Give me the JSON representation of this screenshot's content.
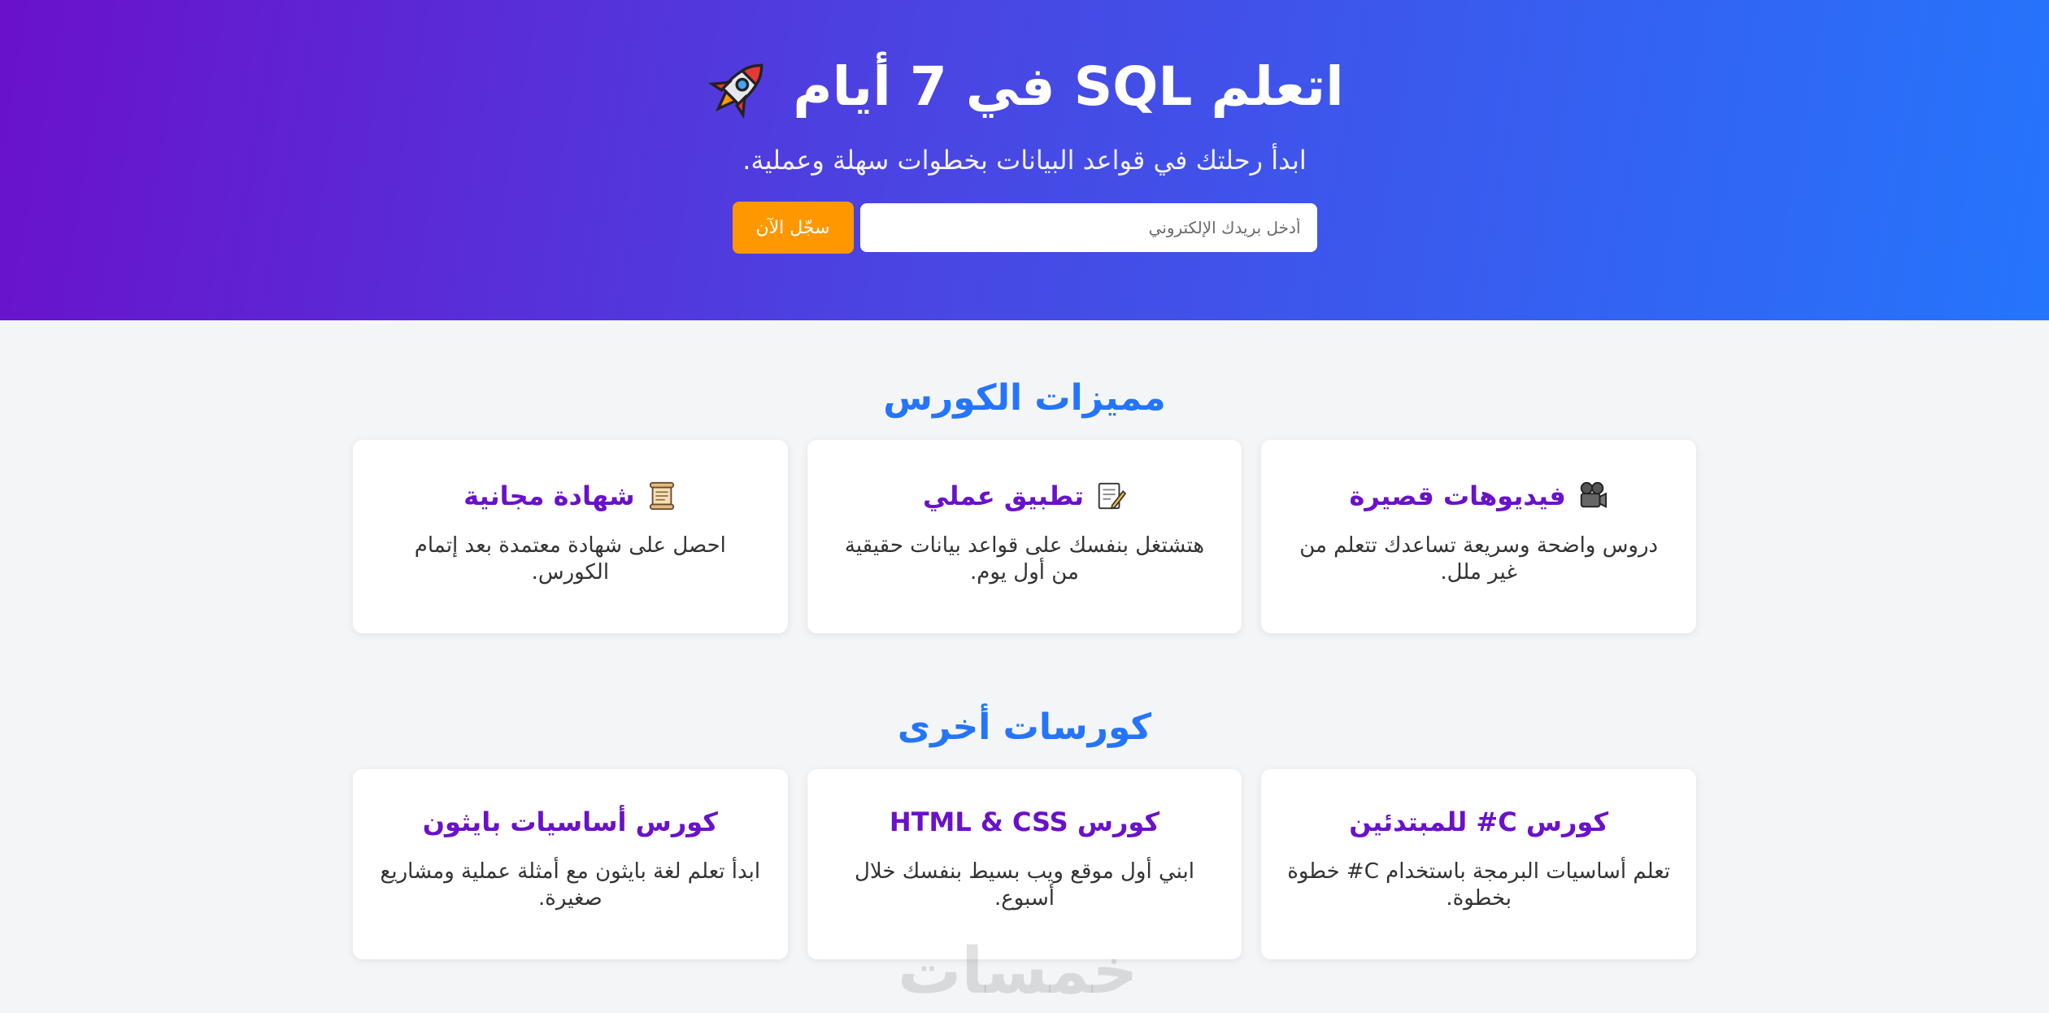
{
  "hero": {
    "title": "اتعلم SQL في 7 أيام",
    "title_icon": "rocket-icon",
    "subtitle": "ابدأ رحلتك في قواعد البيانات بخطوات سهلة وعملية.",
    "email_placeholder": "أدخل بريدك الإلكتروني",
    "email_value": "",
    "register_label": "سجّل الآن",
    "colors": {
      "gradient_start": "#6a11cb",
      "gradient_end": "#2575fc",
      "button": "#ff9800"
    }
  },
  "features": {
    "title": "مميزات الكورس",
    "items": [
      {
        "icon": "film-camera-icon",
        "title": "فيديوهات قصيرة",
        "text": "دروس واضحة وسريعة تساعدك تتعلم من غير ملل."
      },
      {
        "icon": "memo-icon",
        "title": "تطبيق عملي",
        "text": "هتشتغل بنفسك على قواعد بيانات حقيقية من أول يوم."
      },
      {
        "icon": "scroll-icon",
        "title": "شهادة مجانية",
        "text": "احصل على شهادة معتمدة بعد إتمام الكورس."
      }
    ]
  },
  "courses": {
    "title": "كورسات أخرى",
    "items": [
      {
        "title": "كورس C# للمبتدئين",
        "text": "تعلم أساسيات البرمجة باستخدام C# خطوة بخطوة."
      },
      {
        "title": "كورس HTML & CSS",
        "text": "ابني أول موقع ويب بسيط بنفسك خلال أسبوع."
      },
      {
        "title": "كورس أساسيات بايثون",
        "text": "ابدأ تعلم لغة بايثون مع أمثلة عملية ومشاريع صغيرة."
      }
    ]
  },
  "watermark": "خمسات",
  "colors": {
    "accent": "#2575fc",
    "card_title": "#6a11cb",
    "background": "#f4f5f7"
  }
}
